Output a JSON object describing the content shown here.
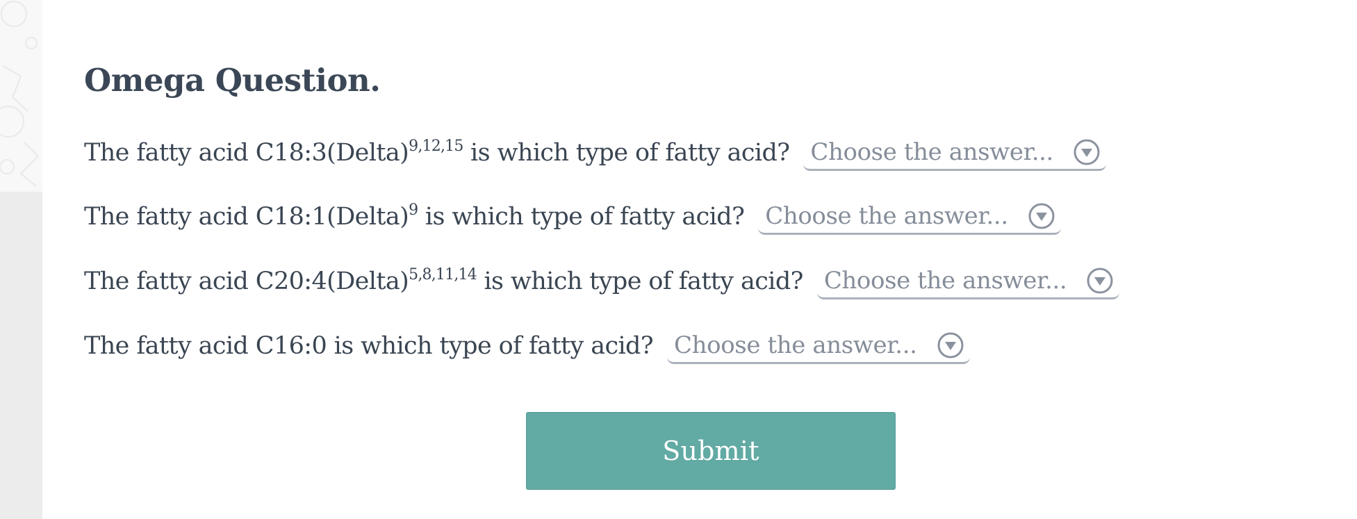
{
  "title": "Omega Question.",
  "questions": [
    {
      "prefix": "The fatty acid C18:3(Delta)",
      "superscript": "9,12,15",
      "suffix": " is which type of fatty acid?",
      "select_value": "Choose the answer..."
    },
    {
      "prefix": "The fatty acid C18:1(Delta)",
      "superscript": "9",
      "suffix": " is which type of fatty acid?",
      "select_value": "Choose the answer..."
    },
    {
      "prefix": "The fatty acid C20:4(Delta)",
      "superscript": "5,8,11,14",
      "suffix": " is which type of fatty acid?",
      "select_value": "Choose the answer..."
    },
    {
      "prefix": "The fatty acid C16:0 is which type of fatty acid?",
      "superscript": "",
      "suffix": "",
      "select_value": "Choose the answer..."
    }
  ],
  "submit_label": "Submit",
  "icons": {
    "dropdown": "chevron-down-circle-icon"
  },
  "colors": {
    "text": "#3a4552",
    "placeholder": "#858d99",
    "underline": "#aab1bb",
    "submit_bg": "#62aaa4",
    "submit_text": "#ffffff",
    "rail": "#ececec"
  }
}
